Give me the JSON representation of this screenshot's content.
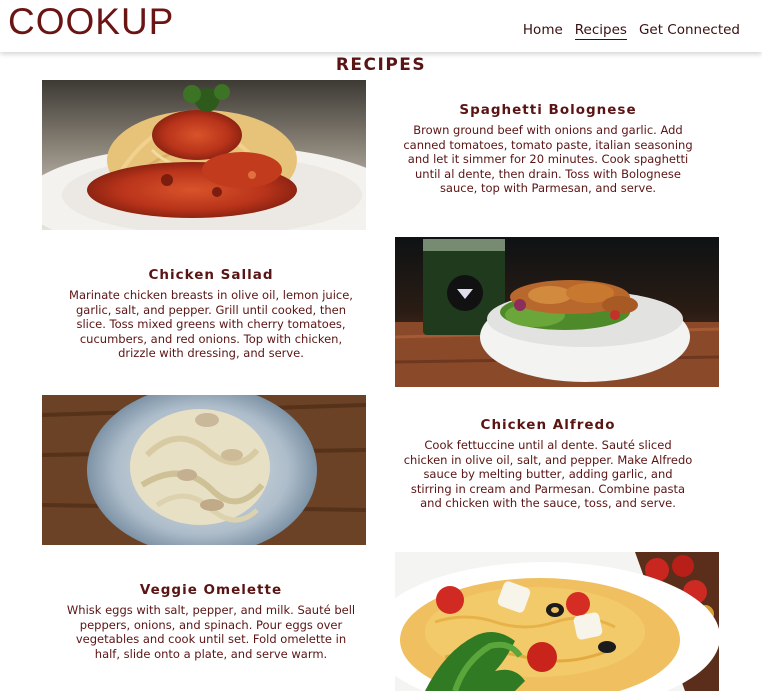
{
  "header": {
    "logo": "COOKUP",
    "nav": [
      {
        "label": "Home",
        "active": false
      },
      {
        "label": "Recipes",
        "active": true
      },
      {
        "label": "Get Connected",
        "active": false
      }
    ]
  },
  "page": {
    "title": "RECIPES"
  },
  "recipes": [
    {
      "title": "Spaghetti Bolognese",
      "description": "Brown ground beef with onions and garlic. Add canned tomatoes, tomato paste, italian seasoning and let it simmer for 20 minutes. Cook spaghetti until al dente, then drain. Toss with Bolognese sauce, top with Parmesan, and serve."
    },
    {
      "title": "Chicken Sallad",
      "description": "Marinate chicken breasts in olive oil, lemon juice, garlic, salt, and pepper. Grill until cooked, then slice. Toss mixed greens with cherry tomatoes, cucumbers, and red onions. Top with chicken, drizzle with dressing, and serve."
    },
    {
      "title": "Chicken Alfredo",
      "description": "Cook fettuccine until al dente. Sauté sliced chicken in olive oil, salt, and pepper. Make Alfredo sauce by melting butter, adding garlic, and stirring in cream and Parmesan. Combine pasta and chicken with the sauce, toss, and serve."
    },
    {
      "title": "Veggie Omelette",
      "description": "Whisk eggs with salt, pepper, and milk. Sauté bell peppers, onions, and spinach. Pour eggs over vegetables and cook until set. Fold omelette in half, slide onto a plate, and serve warm."
    }
  ],
  "colors": {
    "brand": "#6b1414",
    "text": "#5b1414",
    "nav": "#3a1010"
  }
}
